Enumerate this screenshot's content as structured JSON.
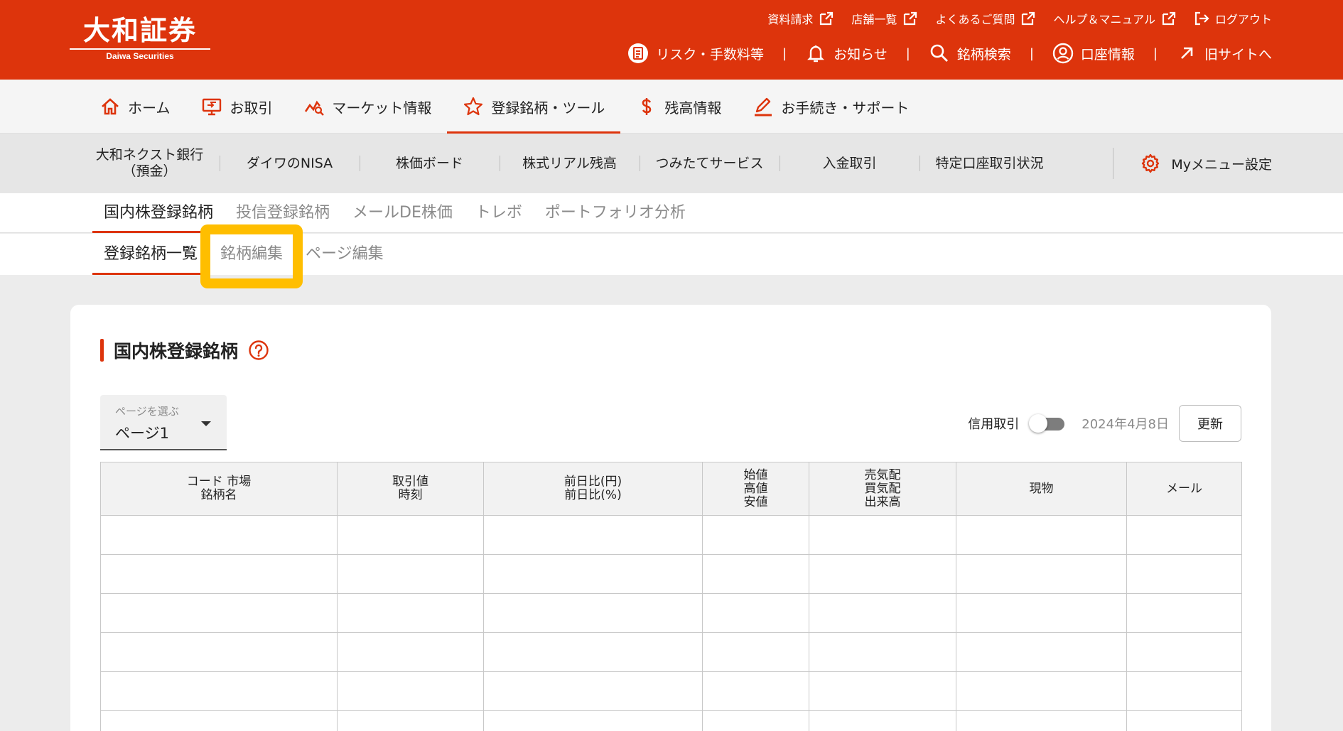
{
  "logo": {
    "main": "大和証券",
    "sub": "Daiwa Securities"
  },
  "header": {
    "util_links": [
      {
        "label": "資料請求",
        "icon": "external-link-icon"
      },
      {
        "label": "店舗一覧",
        "icon": "external-link-icon"
      },
      {
        "label": "よくあるご質問",
        "icon": "external-link-icon"
      },
      {
        "label": "ヘルプ＆マニュアル",
        "icon": "external-link-icon"
      },
      {
        "label": "ログアウト",
        "icon": "logout-icon"
      }
    ],
    "main_links": [
      {
        "label": "リスク・手数料等",
        "icon": "document-icon"
      },
      {
        "label": "お知らせ",
        "icon": "bell-icon"
      },
      {
        "label": "銘柄検索",
        "icon": "search-icon"
      },
      {
        "label": "口座情報",
        "icon": "user-icon"
      },
      {
        "label": "旧サイトへ",
        "icon": "arrow-up-right-icon"
      }
    ],
    "separator": "|"
  },
  "main_nav": [
    {
      "label": "ホーム",
      "icon": "home-icon"
    },
    {
      "label": "お取引",
      "icon": "trade-monitor-icon"
    },
    {
      "label": "マーケット情報",
      "icon": "market-chart-icon"
    },
    {
      "label": "登録銘柄・ツール",
      "icon": "star-icon",
      "active": true
    },
    {
      "label": "残高情報",
      "icon": "dollar-icon"
    },
    {
      "label": "お手続き・サポート",
      "icon": "pencil-icon"
    }
  ],
  "my_menu": {
    "items": [
      "大和ネクスト銀行\n（預金）",
      "ダイワのNISA",
      "株価ボード",
      "株式リアル残高",
      "つみたてサービス",
      "入金取引",
      "特定口座取引状況"
    ],
    "settings_label": "Myメニュー設定"
  },
  "sub_tabs": [
    {
      "label": "国内株登録銘柄",
      "active": true
    },
    {
      "label": "投信登録銘柄"
    },
    {
      "label": "メールDE株価"
    },
    {
      "label": "トレボ"
    },
    {
      "label": "ポートフォリオ分析"
    }
  ],
  "sub_tabs2": [
    {
      "label": "登録銘柄一覧",
      "active": true
    },
    {
      "label": "銘柄編集",
      "highlighted": true
    },
    {
      "label": "ページ編集"
    }
  ],
  "content": {
    "title": "国内株登録銘柄",
    "page_select": {
      "label": "ページを選ぶ",
      "value": "ページ1"
    },
    "margin_toggle_label": "信用取引",
    "margin_toggle_on": false,
    "date": "2024年4月8日",
    "refresh_label": "更新",
    "table": {
      "headers": [
        "コード 市場\n銘柄名",
        "取引値\n時刻",
        "前日比(円)\n前日比(%)",
        "始値\n高値\n安値",
        "売気配\n買気配\n出来高",
        "現物",
        "メール"
      ],
      "row_count": 6
    }
  },
  "colors": {
    "brand": "#dd340c",
    "highlight": "#ffbe00"
  }
}
